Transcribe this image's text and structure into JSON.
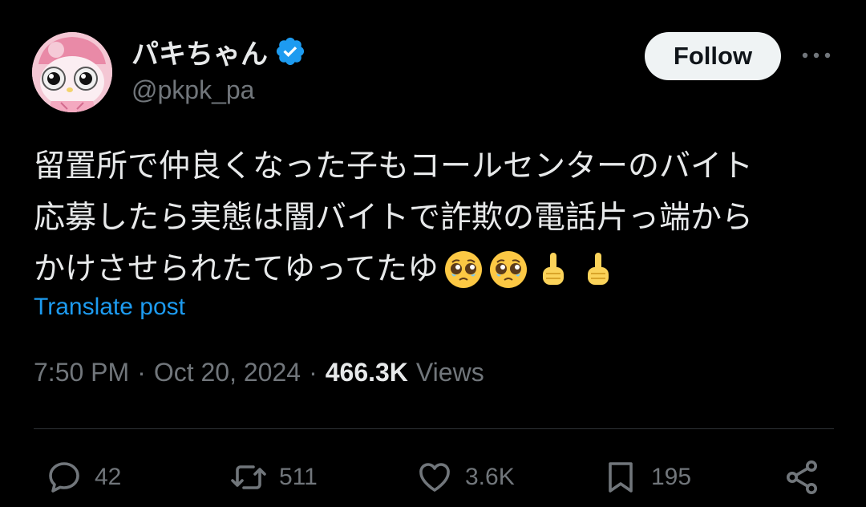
{
  "user": {
    "display_name": "パキちゃん",
    "handle": "@pkpk_pa",
    "avatar": "my-melody-avatar",
    "verified_icon": "verified-badge-icon"
  },
  "header": {
    "follow_label": "Follow",
    "more_icon": "more-options-icon"
  },
  "tweet": {
    "lines": [
      "留置所で仲良くなった子もコールセンターのバイト",
      "応募したら実態は闇バイトで詐欺の電話片っ端から",
      "かけさせられたてゆってたゆ"
    ],
    "emojis": [
      "pleading-face-icon",
      "pleading-face-icon",
      "pointing-up-icon",
      "pointing-up-icon"
    ],
    "translate_label": "Translate post"
  },
  "meta": {
    "time": "7:50 PM",
    "separator": "·",
    "date": "Oct 20, 2024",
    "views_count": "466.3K",
    "views_label": "Views"
  },
  "actions": {
    "replies": "42",
    "reposts": "511",
    "likes": "3.6K",
    "bookmarks": "195"
  },
  "colors": {
    "background": "#000000",
    "text": "#e7e9ea",
    "secondary": "#71767b",
    "accent": "#1d9bf0",
    "divider": "#2f3336"
  }
}
